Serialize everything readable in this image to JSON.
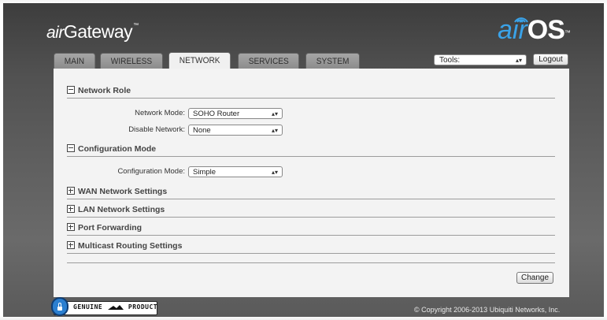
{
  "header": {
    "brand_prefix": "air",
    "brand_name": "Gateway",
    "brand_tm": "™",
    "logo_air": "air",
    "logo_os": "OS",
    "logo_tm": "™",
    "accent_color": "#3aa2e8"
  },
  "tabs": [
    {
      "label": "MAIN",
      "active": false
    },
    {
      "label": "WIRELESS",
      "active": false
    },
    {
      "label": "NETWORK",
      "active": true
    },
    {
      "label": "SERVICES",
      "active": false
    },
    {
      "label": "SYSTEM",
      "active": false
    }
  ],
  "toolbar": {
    "tools_value": "Tools:",
    "logout_label": "Logout"
  },
  "sections": {
    "network_role": {
      "title": "Network Role",
      "expanded": true,
      "network_mode_label": "Network Mode:",
      "network_mode_value": "SOHO Router",
      "disable_network_label": "Disable Network:",
      "disable_network_value": "None"
    },
    "configuration_mode": {
      "title": "Configuration Mode",
      "expanded": true,
      "config_mode_label": "Configuration Mode:",
      "config_mode_value": "Simple"
    },
    "wan": {
      "title": "WAN Network Settings",
      "expanded": false
    },
    "lan": {
      "title": "LAN Network Settings",
      "expanded": false
    },
    "port_forwarding": {
      "title": "Port Forwarding",
      "expanded": false
    },
    "multicast": {
      "title": "Multicast Routing Settings",
      "expanded": false
    }
  },
  "actions": {
    "change_label": "Change"
  },
  "footer": {
    "badge_left": "GENUINE",
    "badge_right": "PRODUCT",
    "copyright": "© Copyright 2006-2013 Ubiquiti Networks, Inc."
  }
}
